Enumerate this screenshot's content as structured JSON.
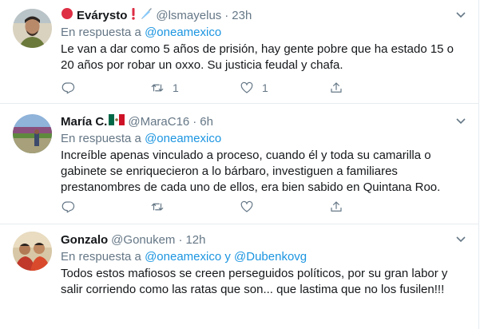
{
  "tweets": [
    {
      "name": "Evárysto",
      "handle": "@lsmayelus",
      "time": "23h",
      "reply_prefix": "En respuesta a",
      "reply_to": "@oneamexico",
      "reply_conjunction": "",
      "reply_to_2": "",
      "text": "Le van a dar como 5 años de prisión, hay gente pobre que ha estado 15 o 20 años por robar un oxxo. Su justicia feudal y chafa.",
      "replies": "",
      "retweets": "1",
      "likes": "1",
      "emojis": [
        "red-circle-icon",
        "exclamation-icon",
        "syringe-icon"
      ]
    },
    {
      "name": "María C.",
      "handle": "@MaraC16",
      "time": "6h",
      "reply_prefix": "En respuesta a",
      "reply_to": "@oneamexico",
      "reply_conjunction": "",
      "reply_to_2": "",
      "text": "Increíble apenas vinculado a proceso, cuando él y toda su camarilla o gabinete se enriquecieron a lo bárbaro, investiguen a familiares prestanombres de cada uno de ellos, era bien sabido en Quintana Roo.",
      "replies": "",
      "retweets": "",
      "likes": "",
      "emojis": [
        "mexico-flag-icon"
      ]
    },
    {
      "name": "Gonzalo",
      "handle": "@Gonukem",
      "time": "12h",
      "reply_prefix": "En respuesta a",
      "reply_to": "@oneamexico",
      "reply_conjunction": "y",
      "reply_to_2": "@Dubenkovg",
      "text": "Todos estos mafiosos se creen perseguidos políticos,  por su gran labor y salir corriendo como las ratas que son... que lastima que no los fusilen!!!",
      "replies": "",
      "retweets": "",
      "likes": "",
      "emojis": []
    }
  ],
  "colors": {
    "link": "#1b95e0",
    "secondary": "#657786",
    "text": "#14171a",
    "divider": "#e6ecf0"
  },
  "separator": "·"
}
